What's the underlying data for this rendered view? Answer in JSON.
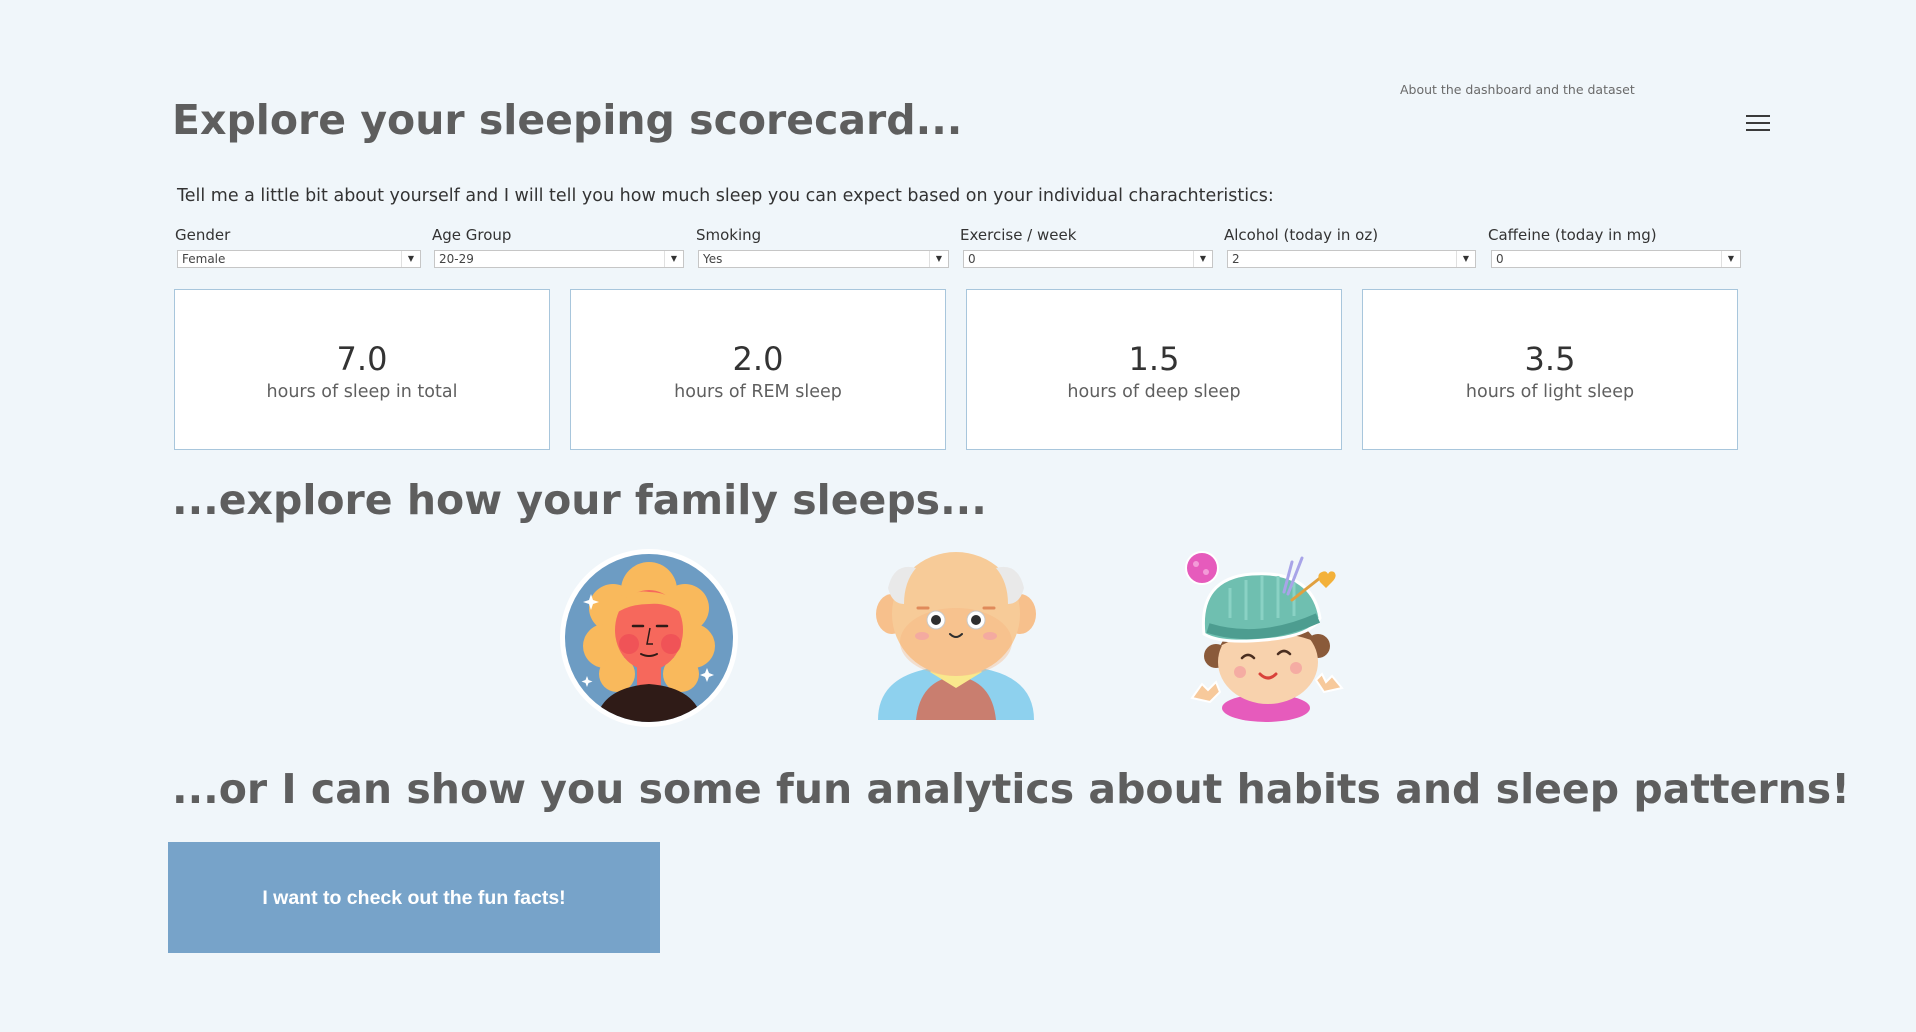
{
  "header": {
    "about_link": "About the dashboard and the dataset",
    "menu_icon": "hamburger-menu-icon"
  },
  "title": "Explore your sleeping scorecard...",
  "intro": "Tell me a little bit about yourself and I will tell you how much sleep you can expect based on your individual charachteristics:",
  "filters": [
    {
      "label": "Gender",
      "value": "Female"
    },
    {
      "label": "Age Group",
      "value": "20-29"
    },
    {
      "label": "Smoking",
      "value": "Yes"
    },
    {
      "label": "Exercise / week",
      "value": "0"
    },
    {
      "label": "Alcohol (today in oz)",
      "value": "2"
    },
    {
      "label": "Caffeine (today in mg)",
      "value": "0"
    }
  ],
  "cards": [
    {
      "value": "7.0",
      "label": "hours of sleep in total"
    },
    {
      "value": "2.0",
      "label": "hours of REM sleep"
    },
    {
      "value": "1.5",
      "label": "hours of deep sleep"
    },
    {
      "value": "3.5",
      "label": "hours of light sleep"
    }
  ],
  "family_heading": "...explore how your family sleeps...",
  "family": [
    {
      "icon": "woman-avatar-icon"
    },
    {
      "icon": "grandfather-avatar-icon"
    },
    {
      "icon": "baby-avatar-icon"
    }
  ],
  "analytics_heading": "...or I can show you some fun analytics about habits and sleep patterns!",
  "cta_label": "I want to check out the fun facts!",
  "colors": {
    "background": "#f0f6fa",
    "heading": "#5e5e5e",
    "card_border": "#a8c6dc",
    "button": "#77a3c9"
  }
}
